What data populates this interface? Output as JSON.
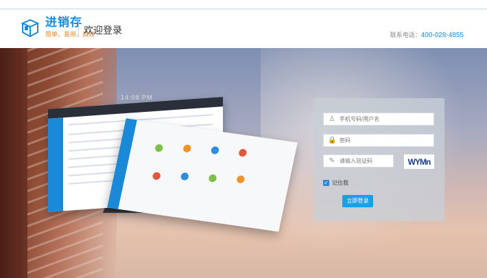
{
  "header": {
    "brand_name": "进销存",
    "brand_slogan": "简单、易用、高效",
    "welcome": "欢迎登录",
    "contact_label": "联系电话：",
    "contact_phone": "400-028-4855"
  },
  "showcase": {
    "time": "14:08 PM"
  },
  "login": {
    "username_placeholder": "手机号码/用户名",
    "password_placeholder": "密码",
    "captcha_placeholder": "请输入验证码",
    "captcha_text": "WYMn",
    "remember_label": "记住我",
    "remember_checked": true,
    "submit_label": "立即登录"
  },
  "colors": {
    "brand": "#1a8ad8",
    "slogan": "#e6852a",
    "button": "#1aa0e6"
  }
}
